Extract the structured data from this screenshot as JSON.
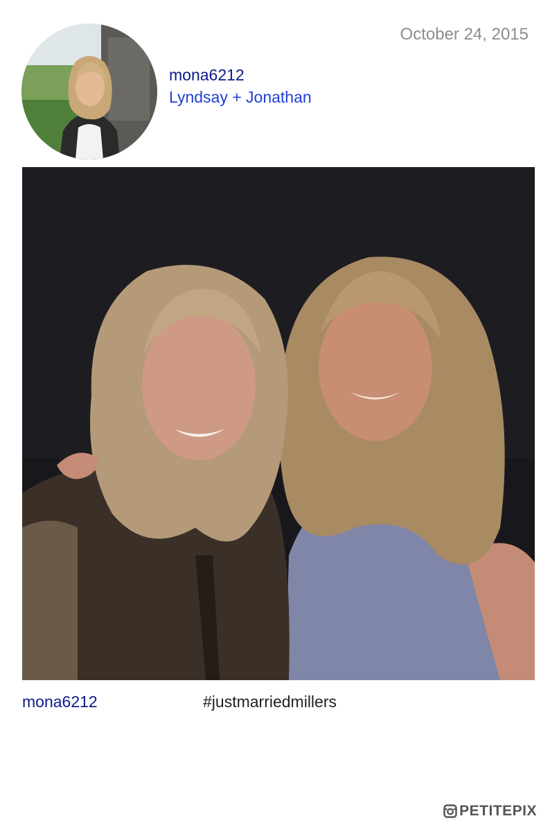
{
  "post": {
    "date": "October 24, 2015",
    "username": "mona6212",
    "caption": "Lyndsay + Jonathan",
    "hashtag": "#justmarriedmillers"
  },
  "avatar": {
    "icon": "avatar-photo",
    "description_kind": "profile-photo"
  },
  "photo": {
    "icon": "photo"
  },
  "brand": {
    "name": "PETITEPIX",
    "icon": "instagram-icon"
  },
  "colors": {
    "username": "#0d1a8c",
    "caption": "#1f3fd6",
    "date": "#8c8c8c",
    "brand": "#555555"
  }
}
